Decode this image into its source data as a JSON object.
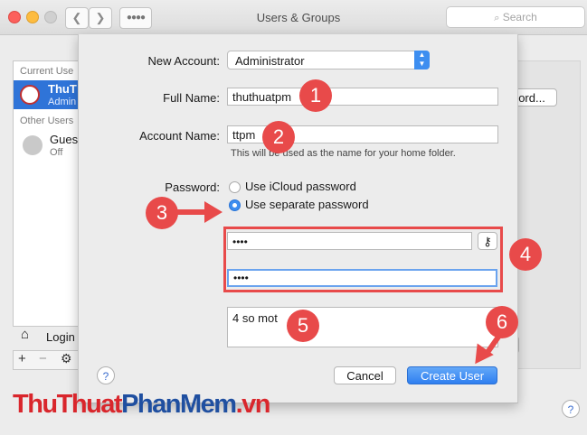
{
  "window": {
    "title": "Users & Groups",
    "search_placeholder": "Search"
  },
  "users_list": {
    "current_users_header": "Current Use",
    "current_user_name": "ThuT",
    "current_user_role": "Admin",
    "other_users_header": "Other Users",
    "guest_name": "Gues",
    "guest_status": "Off",
    "login_label": "Login",
    "add_symbol": "+",
    "remove_symbol": "−"
  },
  "background": {
    "password_button_fragment": "ord..."
  },
  "sheet": {
    "new_account_label": "New Account:",
    "new_account_value": "Administrator",
    "full_name_label": "Full Name:",
    "full_name_value": "thuthuatpm",
    "account_name_label": "Account Name:",
    "account_name_value": "ttpm",
    "account_name_hint": "This will be used as the name for your home folder.",
    "password_label": "Password:",
    "radio_icloud": "Use iCloud password",
    "radio_separate": "Use separate password",
    "password_value": "••••",
    "verify_value": "••••",
    "hint_value": "4 so mot",
    "cancel_label": "Cancel",
    "create_label": "Create User",
    "help_label": "?"
  },
  "annotations": {
    "n1": "1",
    "n2": "2",
    "n3": "3",
    "n4": "4",
    "n5": "5",
    "n6": "6"
  },
  "watermark": {
    "part1": "Thu",
    "part2": "Thuat",
    "part3": "PhanMem",
    "part4": ".vn"
  },
  "colors": {
    "accent": "#3d8ef0",
    "annotation_red": "#e84a4a",
    "watermark_red": "#d9262c",
    "watermark_blue": "#1f4fa0"
  }
}
